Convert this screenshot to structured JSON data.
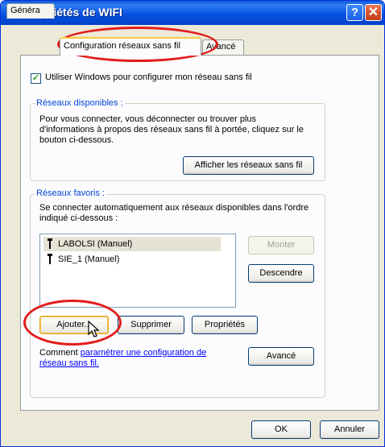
{
  "window": {
    "title": "Propriétés de WIFI"
  },
  "tabs": [
    {
      "label": "Généra"
    },
    {
      "label": "Configuration réseaux sans fil"
    },
    {
      "label": "Avancé"
    }
  ],
  "use_windows": {
    "label": "Utiliser Windows pour configurer mon réseau sans fil",
    "checked": true
  },
  "available": {
    "legend": "Réseaux disponibles :",
    "description": "Pour vous connecter, vous déconnecter ou trouver plus d'informations à propos des réseaux sans fil à portée, cliquez sur le bouton ci-dessous.",
    "show_button": "Afficher les réseaux sans fil"
  },
  "preferred": {
    "legend": "Réseaux favoris :",
    "description": "Se connecter automatiquement aux réseaux disponibles dans l'ordre indiqué ci-dessous :",
    "networks": [
      "LABOLSI (Manuel)",
      "SIE_1 (Manuel)"
    ],
    "selected_index": 0,
    "up_button": "Monter",
    "down_button": "Descendre",
    "add_button": "Ajouter...",
    "remove_button": "Supprimer",
    "properties_button": "Propriétés",
    "help_prefix": "Comment ",
    "help_link": "paramétrer une configuration de réseau sans fil.",
    "advanced_button": "Avancé"
  },
  "footer": {
    "ok": "OK",
    "cancel": "Annuler"
  },
  "colors": {
    "titlebar": "#0553e1",
    "annotation": "#e21d1d",
    "link": "#0000ff",
    "group_label": "#0046d5"
  }
}
